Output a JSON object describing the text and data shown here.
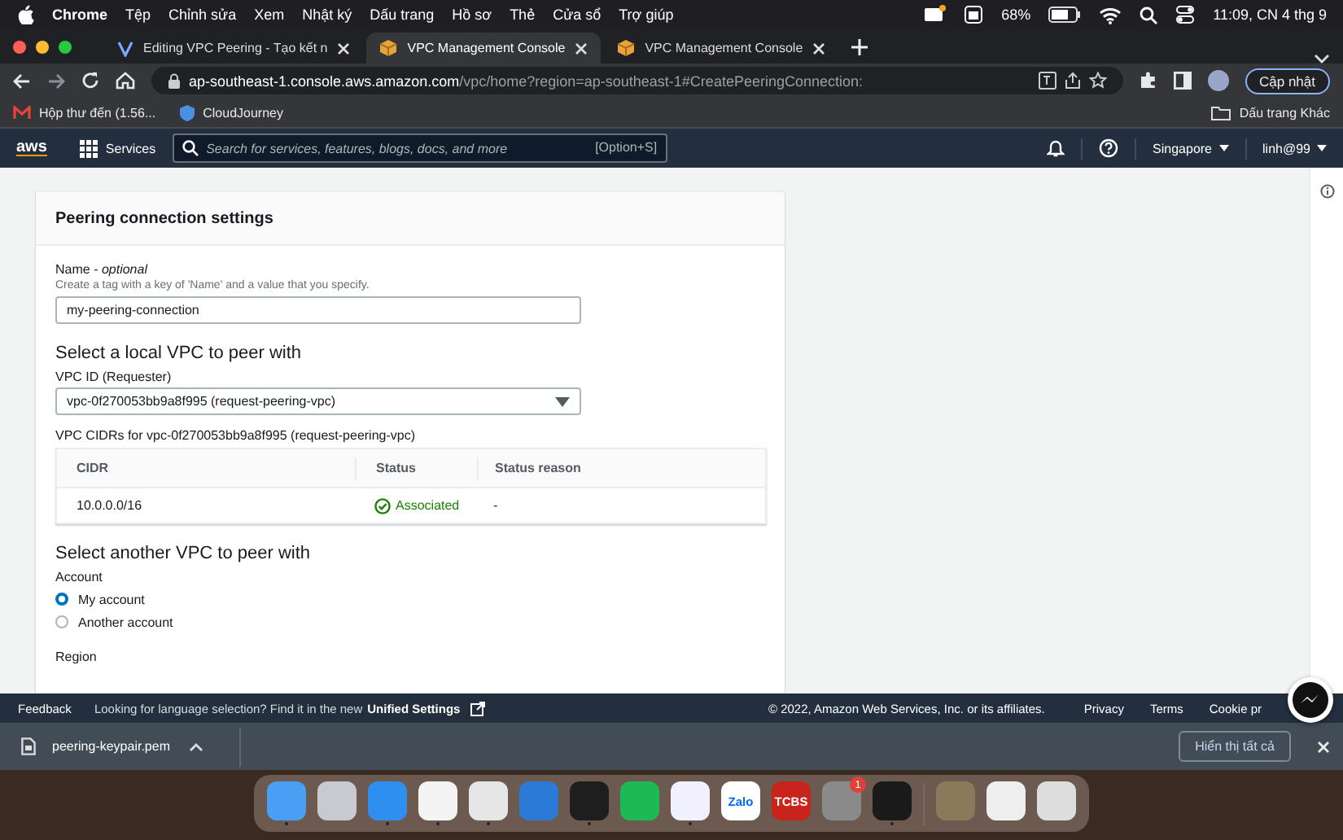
{
  "menubar": {
    "app": "Chrome",
    "menus": [
      "Tệp",
      "Chỉnh sửa",
      "Xem",
      "Nhật ký",
      "Dấu trang",
      "Hồ sơ",
      "Thẻ",
      "Cửa sổ",
      "Trợ giúp"
    ],
    "battery": "68%",
    "clock": "11:09, CN 4 thg 9"
  },
  "tabs": [
    {
      "title": "Editing VPC Peering - Tạo kết n",
      "kind": "doc",
      "selected": false
    },
    {
      "title": "VPC Management Console",
      "kind": "aws",
      "selected": true
    },
    {
      "title": "VPC Management Console",
      "kind": "aws",
      "selected": false
    }
  ],
  "address": {
    "host": "ap-southeast-1.console.aws.amazon.com",
    "path": "/vpc/home?region=ap-southeast-1#CreatePeeringConnection:",
    "update_button": "Cập nhật"
  },
  "bookmarks": [
    {
      "label": "Hộp thư đến (1.56...",
      "kind": "mail"
    },
    {
      "label": "CloudJourney",
      "kind": "cloud"
    }
  ],
  "other_bookmarks": "Dấu trang Khác",
  "aws_nav": {
    "logo": "aws",
    "services": "Services",
    "search_placeholder": "Search for services, features, blogs, docs, and more",
    "shortcut": "[Option+S]",
    "region": "Singapore",
    "user": "linh@99"
  },
  "panel": {
    "title": "Peering connection settings",
    "name_label": "Name - *optional*",
    "name_hint": "Create a tag with a key of 'Name' and a value that you specify.",
    "name_value": "my-peering-connection",
    "local_heading": "Select a local VPC to peer with",
    "vpc_label": "VPC ID (Requester)",
    "vpc_value": "vpc-0f270053bb9a8f995 (request-peering-vpc)",
    "cidr_caption": "VPC CIDRs for vpc-0f270053bb9a8f995 (request-peering-vpc)",
    "table": {
      "columns": [
        "CIDR",
        "Status",
        "Status reason"
      ],
      "rows": [
        {
          "cidr": "10.0.0.0/16",
          "status": "Associated",
          "reason": "-"
        }
      ]
    },
    "another_heading": "Select another VPC to peer with",
    "account_label": "Account",
    "accounts": [
      {
        "label": "My account",
        "selected": true
      },
      {
        "label": "Another account",
        "selected": false
      }
    ],
    "region_label": "Region"
  },
  "footer": {
    "feedback": "Feedback",
    "language_note": "Looking for language selection? Find it in the new",
    "unified_settings": "Unified Settings",
    "copyright": "© 2022, Amazon Web Services, Inc. or its affiliates.",
    "links": [
      "Privacy",
      "Terms",
      "Cookie pr"
    ]
  },
  "download": {
    "file": "peering-keypair.pem",
    "show_all": "Hiển thị tất cả"
  },
  "dock": [
    {
      "kind": "app",
      "color": "#4a9ff5",
      "running": true
    },
    {
      "kind": "app",
      "color": "#c9c9d1",
      "running": false
    },
    {
      "kind": "app",
      "color": "#2f8ff0",
      "running": true
    },
    {
      "kind": "app",
      "color": "#f4f4f4",
      "running": true
    },
    {
      "kind": "app",
      "color": "#e6e6e6",
      "running": true
    },
    {
      "kind": "app",
      "color": "#2a7ad6",
      "running": false
    },
    {
      "kind": "app",
      "color": "#1e1e1e",
      "running": true
    },
    {
      "kind": "app",
      "color": "#1db954",
      "running": false
    },
    {
      "kind": "app",
      "color": "#f0f0ff",
      "running": true
    },
    {
      "kind": "label",
      "label": "Zalo",
      "color": "#ffffff",
      "running": false
    },
    {
      "kind": "label",
      "label": "TCBS",
      "color": "#c8241c",
      "running": false
    },
    {
      "kind": "app",
      "color": "#8a8a8a",
      "running": false,
      "badge": "1"
    },
    {
      "kind": "app",
      "color": "#1a1a1a",
      "running": true
    },
    {
      "kind": "sep"
    },
    {
      "kind": "app",
      "color": "#8a7a5a",
      "running": false
    },
    {
      "kind": "app",
      "color": "#eeeeee",
      "running": false
    },
    {
      "kind": "app",
      "color": "#dddddd",
      "running": false
    }
  ]
}
